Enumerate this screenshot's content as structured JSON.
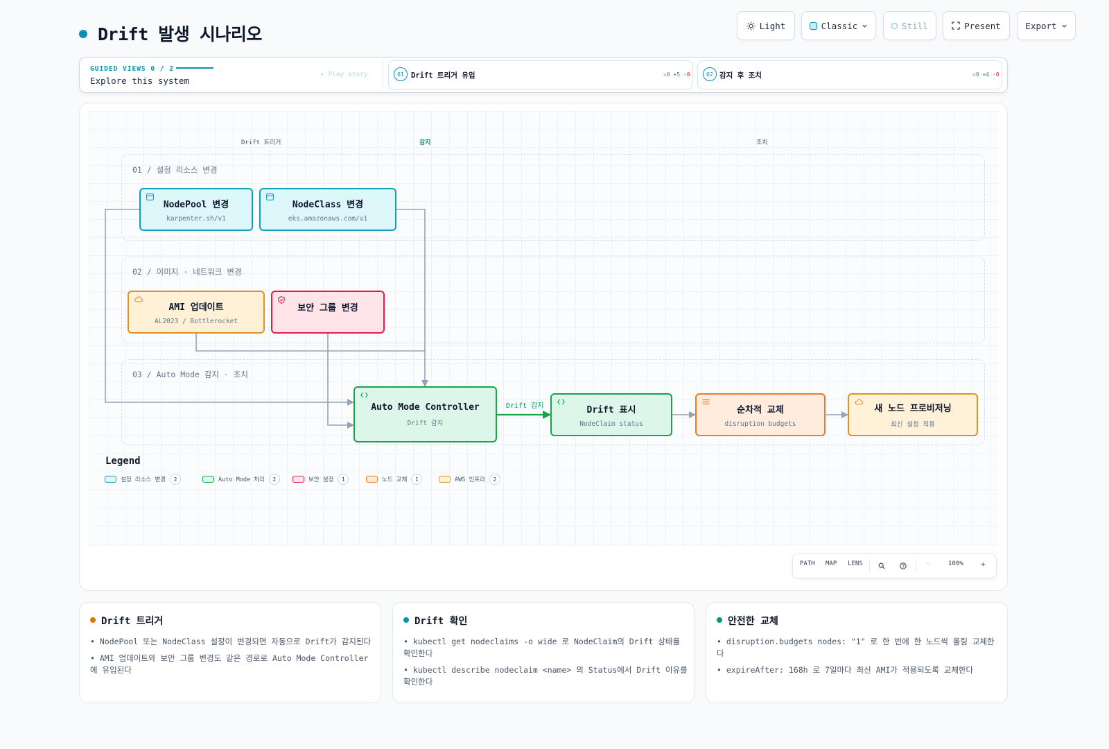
{
  "page": {
    "title": "Drift 발생 시나리오"
  },
  "toolbar": {
    "theme_label": "Light",
    "style_label": "Classic",
    "motion_label": "Still",
    "present_label": "Present",
    "export_label": "Export"
  },
  "guided": {
    "heading": "GUIDED VIEWS 0 / 2",
    "subtitle": "Explore this system",
    "play_label": "▸ Play story",
    "views": [
      {
        "num": "01",
        "label": "Drift 트리거 유입",
        "eq": "=0",
        "plus": "+5",
        "minus": "-0"
      },
      {
        "num": "02",
        "label": "감지 후 조치",
        "eq": "=0",
        "plus": "+4",
        "minus": "-0"
      }
    ]
  },
  "diagram": {
    "columns": [
      "Drift 트리거",
      "감지",
      "조치"
    ],
    "groups": [
      {
        "title": "01 / 설정 리소스 변경"
      },
      {
        "title": "02 / 이미지 · 네트워크 변경"
      },
      {
        "title": "03 / Auto Mode 감지 · 조치"
      }
    ],
    "nodes": {
      "nodepool": {
        "title": "NodePool 변경",
        "sub": "karpenter.sh/v1",
        "icon": "window-icon"
      },
      "nodeclass": {
        "title": "NodeClass 변경",
        "sub": "eks.amazonaws.com/v1",
        "icon": "window-icon"
      },
      "ami": {
        "title": "AMI 업데이트",
        "sub": "AL2023 / Bottlerocket",
        "icon": "cloud-icon"
      },
      "sg": {
        "title": "보안 그룹 변경",
        "sub": "",
        "icon": "shield-icon"
      },
      "controller": {
        "title": "Auto Mode Controller",
        "sub": "Drift 감지",
        "icon": "code-icon"
      },
      "drift": {
        "title": "Drift 표시",
        "sub": "NodeClaim status",
        "icon": "code-icon"
      },
      "replace": {
        "title": "순차적 교체",
        "sub": "disruption budgets",
        "icon": "list-icon"
      },
      "provision": {
        "title": "새 노드 프로비저닝",
        "sub": "최신 설정 적용",
        "icon": "cloud-icon"
      }
    },
    "edge_label": "Drift 감지",
    "colors": {
      "cyan": "#0e9fb8",
      "green": "#16a34a",
      "red": "#e11d48",
      "orange": "#ea7b27",
      "amber": "#e0921c",
      "edge": "#94a3b8"
    }
  },
  "legend": {
    "title": "Legend",
    "items": [
      {
        "label": "설정 리소스 변경",
        "count": "2"
      },
      {
        "label": "Auto Mode 처리",
        "count": "2"
      },
      {
        "label": "보안 설정",
        "count": "1"
      },
      {
        "label": "노드 교체",
        "count": "1"
      },
      {
        "label": "AWS 인프라",
        "count": "2"
      }
    ]
  },
  "zoom": {
    "path": "PATH",
    "map": "MAP",
    "lens": "LENS",
    "minus": "−",
    "level": "100%",
    "plus": "+"
  },
  "cards": [
    {
      "title": "Drift 트리거",
      "dot_color": "#d97706",
      "items": [
        "• NodePool 또는 NodeClass 설정이 변경되면 자동으로 Drift가 감지된다",
        "• AMI 업데이트와 보안 그룹 변경도 같은 경로로 Auto Mode Controller에 유입된다"
      ]
    },
    {
      "title": "Drift 확인",
      "dot_color": "#0891b2",
      "items": [
        "• kubectl get nodeclaims -o wide 로 NodeClaim의 Drift 상태를 확인한다",
        "• kubectl describe nodeclaim <name> 의 Status에서 Drift 이유를 확인한다"
      ]
    },
    {
      "title": "안전한 교체",
      "dot_color": "#059669",
      "items": [
        "• disruption.budgets nodes: \"1\" 로 한 번에 한 노드씩 롤링 교체한다",
        "• expireAfter: 168h 로 7일마다 최신 AMI가 적용되도록 교체한다"
      ]
    }
  ]
}
